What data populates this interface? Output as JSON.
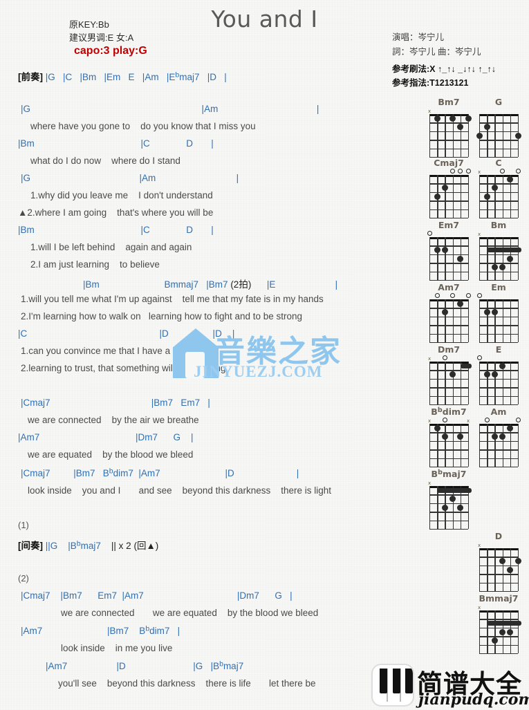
{
  "header": {
    "title": "You and I",
    "orig_key": "原KEY:Bb",
    "suggest_key": "建议男调:E 女:A",
    "capo": "capo:3 play:G",
    "singer": "演唱：岑宁儿",
    "writer": "詞：岑宁儿   曲：岑宁儿",
    "strum": "参考刷法:X ↑_↑↓ _↓↑↓ ↑_↑↓",
    "fingering": "参考指法:T1213121"
  },
  "sections": [
    {
      "name": "intro",
      "label": "[前奏]",
      "chords": "|G    |C    |Bm    |Em    E    |Am    |E♭maj7    |D    |"
    },
    {
      "name": "verse1a",
      "chords": "|G                                                    |Am                                        |",
      "lyrics": [
        "where have you gone to    do you know that I miss you"
      ]
    },
    {
      "name": "verse1b",
      "chords": "|Bm                                |C            D        |",
      "lyrics": [
        "what do I do now    where do I stand"
      ]
    },
    {
      "name": "verse2a",
      "chords": "|G                                    |Am                          |",
      "lyrics": [
        "1.why did you leave me    I don't understand",
        "▲2.where I am going    that's where you will be"
      ]
    },
    {
      "name": "verse2b",
      "chords": "|Bm                                |C            D        |",
      "lyrics": [
        "1.will I be left behind    again and again",
        "2.I am just learning    to believe"
      ]
    },
    {
      "name": "chorus1a",
      "chords": "|Bm                    Bmmaj7   |Bm7 (2拍)       |E                       |",
      "lyrics": [
        "1.will you tell me what I'm up against    tell me that my fate is in my hands",
        "2.I'm learning how to walk on   learning how to fight and to be strong"
      ]
    },
    {
      "name": "chorus1b",
      "chords": "|C                                        |D                    |D        |",
      "lyrics": [
        "1.can you convince me that I have a chance",
        "2.learning to trust, that something will come along"
      ]
    },
    {
      "name": "bridge1",
      "chords": "|Cmaj7                              |Bm7    Em7    |",
      "lyrics": [
        "we are connected    by the air we breathe"
      ]
    },
    {
      "name": "bridge2",
      "chords": "|Am7                                |Dm7        G      |",
      "lyrics": [
        "we are equated    by the blood we bleed"
      ]
    },
    {
      "name": "bridge3",
      "chords": "|Cmaj7            |Bm7   B♭dim7   |Am7                            |D                          |",
      "lyrics": [
        "look inside    you and I       and see    beyond this darkness    there is light"
      ]
    },
    {
      "name": "interlude",
      "marker1": "(1)",
      "label": "[间奏]",
      "chords": "||G     |B♭maj7     || x 2 (回▲)",
      "marker2": "(2)"
    },
    {
      "name": "outro1",
      "chords": "|Cmaj7     |Bm7      Em7   |Am7                                    |Dm7        G     |",
      "lyrics": [
        "we are connected       we are equated    by the blood we bleed"
      ]
    },
    {
      "name": "outro2",
      "chords": "|Am7                        |Bm7     B♭dim7    |",
      "lyrics": [
        "look inside    in me you live"
      ]
    },
    {
      "name": "outro3",
      "chords": "|Am7                    |D                            |G      |B♭maj7",
      "lyrics": [
        "you'll see    beyond this darkness    there is life       let there be"
      ]
    }
  ],
  "chord_diagrams": [
    {
      "name": "Bm7",
      "top": [
        {
          "type": "x",
          "string": 6
        }
      ],
      "dots": [
        {
          "s": 5,
          "f": 1
        },
        {
          "s": 3,
          "f": 1
        },
        {
          "s": 1,
          "f": 1
        },
        {
          "s": 2,
          "f": 2
        }
      ],
      "barre": null
    },
    {
      "name": "G",
      "top": [],
      "dots": [
        {
          "s": 5,
          "f": 2
        },
        {
          "s": 6,
          "f": 3
        },
        {
          "s": 1,
          "f": 3
        }
      ],
      "barre": null
    },
    {
      "name": "Cmaj7",
      "top": [
        {
          "type": "o",
          "string": 3
        },
        {
          "type": "o",
          "string": 2
        },
        {
          "type": "o",
          "string": 1
        }
      ],
      "dots": [
        {
          "s": 4,
          "f": 2
        },
        {
          "s": 5,
          "f": 3
        }
      ],
      "barre": null
    },
    {
      "name": "C",
      "top": [
        {
          "type": "x",
          "string": 6
        },
        {
          "type": "o",
          "string": 3
        },
        {
          "type": "o",
          "string": 1
        }
      ],
      "dots": [
        {
          "s": 2,
          "f": 1
        },
        {
          "s": 4,
          "f": 2
        },
        {
          "s": 5,
          "f": 3
        }
      ],
      "barre": null
    },
    {
      "name": "Em7",
      "top": [
        {
          "type": "o",
          "string": 6
        }
      ],
      "dots": [
        {
          "s": 5,
          "f": 2
        },
        {
          "s": 4,
          "f": 2
        },
        {
          "s": 2,
          "f": 3
        }
      ],
      "barre": null
    },
    {
      "name": "Bm",
      "top": [
        {
          "type": "x",
          "string": 6
        }
      ],
      "dots": [
        {
          "s": 2,
          "f": 3
        },
        {
          "s": 4,
          "f": 4
        },
        {
          "s": 3,
          "f": 4
        }
      ],
      "barre": {
        "fret": 2,
        "from": 5,
        "to": 1
      }
    },
    {
      "name": "Am7",
      "top": [
        {
          "type": "o",
          "string": 5
        },
        {
          "type": "o",
          "string": 3
        },
        {
          "type": "o",
          "string": 1
        }
      ],
      "dots": [
        {
          "s": 4,
          "f": 2
        },
        {
          "s": 2,
          "f": 1
        }
      ],
      "barre": null
    },
    {
      "name": "Em",
      "top": [
        {
          "type": "o",
          "string": 6
        }
      ],
      "dots": [
        {
          "s": 5,
          "f": 2
        },
        {
          "s": 4,
          "f": 2
        }
      ],
      "barre": null
    },
    {
      "name": "Dm7",
      "top": [
        {
          "type": "x",
          "string": 6
        },
        {
          "type": "o",
          "string": 4
        }
      ],
      "dots": [
        {
          "s": 3,
          "f": 2
        }
      ],
      "barre": {
        "fret": 1,
        "from": 2,
        "to": 1
      }
    },
    {
      "name": "E",
      "top": [
        {
          "type": "o",
          "string": 6
        }
      ],
      "dots": [
        {
          "s": 3,
          "f": 1
        },
        {
          "s": 5,
          "f": 2
        },
        {
          "s": 4,
          "f": 2
        }
      ],
      "barre": null
    },
    {
      "name": "Bbdim7",
      "top": [
        {
          "type": "x",
          "string": 6
        },
        {
          "type": "o",
          "string": 4
        },
        {
          "type": "x",
          "string": 1
        }
      ],
      "dots": [
        {
          "s": 5,
          "f": 1
        },
        {
          "s": 4,
          "f": 2
        },
        {
          "s": 2,
          "f": 2
        }
      ],
      "barre": null
    },
    {
      "name": "Am",
      "top": [
        {
          "type": "o",
          "string": 5
        },
        {
          "type": "o",
          "string": 1
        }
      ],
      "dots": [
        {
          "s": 2,
          "f": 1
        },
        {
          "s": 4,
          "f": 2
        },
        {
          "s": 3,
          "f": 2
        }
      ],
      "barre": null
    },
    {
      "name": "Bbmaj7",
      "top": [
        {
          "type": "x",
          "string": 6
        }
      ],
      "dots": [
        {
          "s": 3,
          "f": 2
        },
        {
          "s": 4,
          "f": 3
        },
        {
          "s": 2,
          "f": 3
        }
      ],
      "barre": {
        "fret": 1,
        "from": 5,
        "to": 1
      }
    },
    {
      "name": "D",
      "top": [
        {
          "type": "x",
          "string": 6
        }
      ],
      "dots": [
        {
          "s": 3,
          "f": 2
        },
        {
          "s": 1,
          "f": 2
        },
        {
          "s": 2,
          "f": 3
        }
      ],
      "barre": null
    },
    {
      "name": "Bmmaj7",
      "top": [
        {
          "type": "x",
          "string": 6
        }
      ],
      "dots": [
        {
          "s": 3,
          "f": 3
        },
        {
          "s": 2,
          "f": 3
        },
        {
          "s": 4,
          "f": 4
        }
      ],
      "barre": {
        "fret": 2,
        "from": 5,
        "to": 1
      }
    }
  ],
  "watermarks": {
    "center_cn": "音樂之家",
    "center_en": "JINYUEZJ.COM",
    "logo_cn": "简谱大全",
    "logo_en": "jianpudq.com"
  }
}
